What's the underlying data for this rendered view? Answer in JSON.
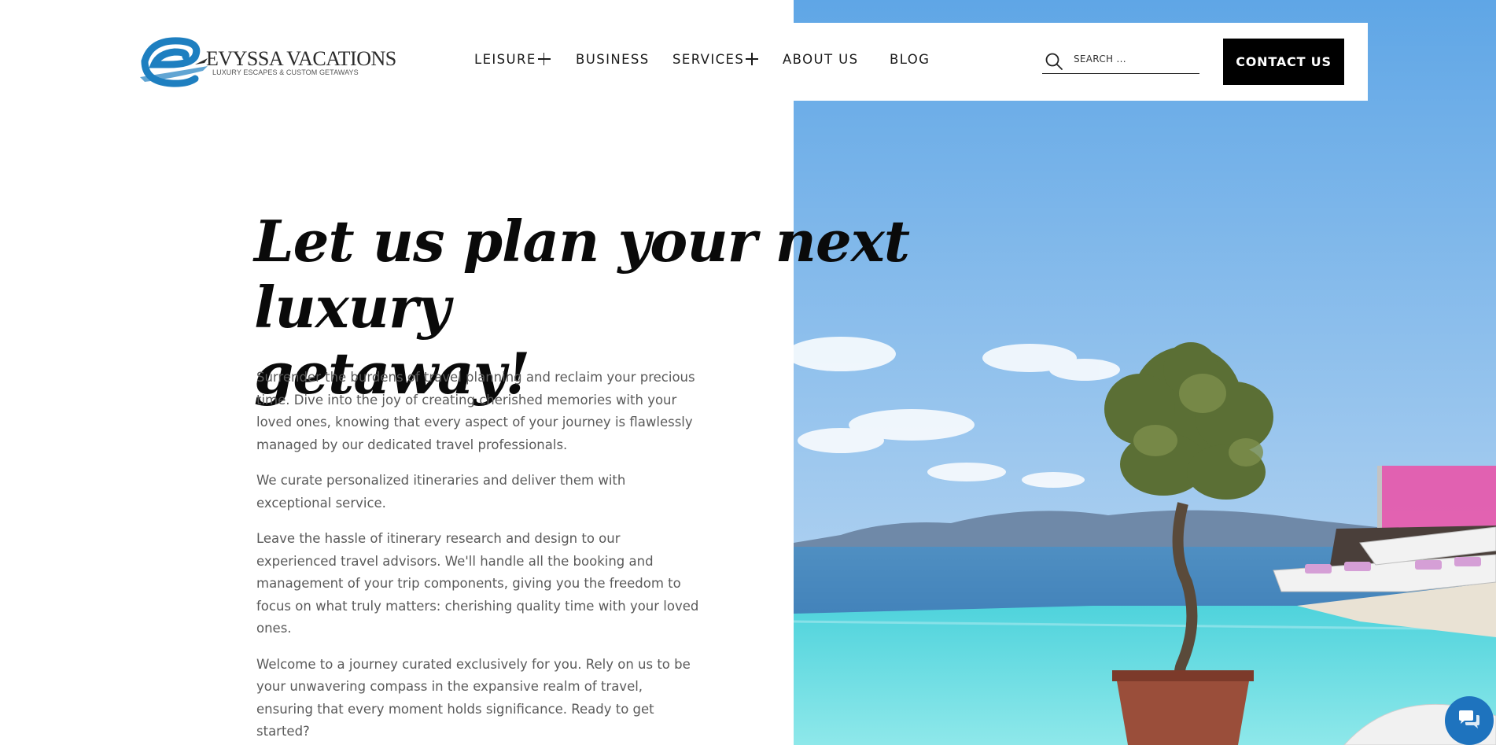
{
  "brand": {
    "name": "EVYSSA VACATIONS",
    "tagline": "LUXURY ESCAPES & CUSTOM GETAWAYS",
    "colors": {
      "blue": "#1e7fc0",
      "dark": "#2b2b2b"
    }
  },
  "nav": {
    "items": [
      {
        "label": "LEISURE",
        "has_submenu": true
      },
      {
        "label": "BUSINESS",
        "has_submenu": false
      },
      {
        "label": "SERVICES",
        "has_submenu": true
      },
      {
        "label": "ABOUT US",
        "has_submenu": false
      },
      {
        "label": "BLOG",
        "has_submenu": false
      }
    ]
  },
  "search": {
    "placeholder": "SEARCH ...",
    "value": "",
    "icon": "search-icon"
  },
  "contact_button": {
    "label": "CONTACT US",
    "bg": "#000000",
    "fg": "#ffffff"
  },
  "hero": {
    "headline_line1": "Let us plan your next luxury",
    "headline_line2": "getaway!",
    "paragraphs": [
      "Surrender the burdens of travel planning and reclaim your precious time. Dive into the joy of creating cherished memories with your loved ones, knowing that every aspect of your journey is flawlessly managed by our dedicated travel professionals.",
      "We curate personalized itineraries and deliver them with exceptional service.",
      "Leave the hassle of itinerary research and design to our experienced travel advisors. We'll handle all the booking and management of your trip components, giving you the freedom to focus on what truly matters: cherishing quality time with your loved ones.",
      "Welcome to a journey curated exclusively for you. Rely on us to be your unwavering compass in the expansive realm of travel, ensuring that every moment holds significance.  Ready to get started?"
    ]
  },
  "chat": {
    "icon": "chat-icon",
    "color": "#1e73be"
  }
}
